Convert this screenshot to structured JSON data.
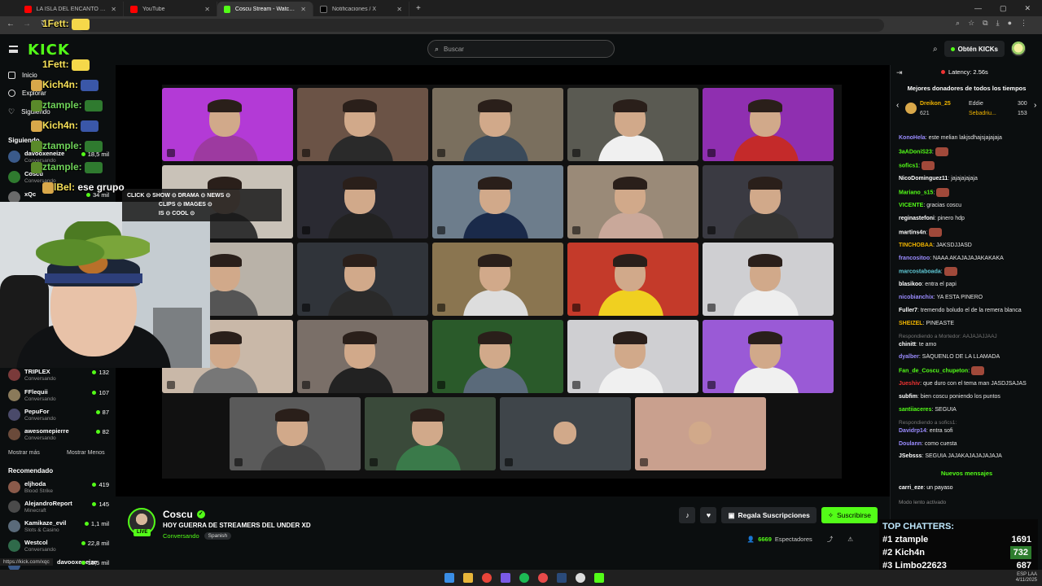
{
  "browser": {
    "tabs": [
      {
        "title": "LA ISLA DEL ENCANTO #81",
        "color": "#ff0000"
      },
      {
        "title": "YouTube",
        "color": "#ff0000"
      },
      {
        "title": "Coscu Stream - Watch Live",
        "color": "#53fc18"
      },
      {
        "title": "Notificaciones / X",
        "color": "#000000"
      }
    ],
    "new_tab": "+"
  },
  "header": {
    "logo": "KICK",
    "search_placeholder": "Buscar",
    "get_kicks": "Obtén KICKs"
  },
  "sidebar": {
    "nav": [
      {
        "label": "Inicio",
        "icon": "home-icon"
      },
      {
        "label": "Explorar",
        "icon": "compass-icon"
      },
      {
        "label": "Siguiendo",
        "icon": "heart-icon"
      }
    ],
    "following_title": "Siguiendo",
    "following": [
      {
        "name": "davooxeneize",
        "category": "Conversando",
        "viewers": "18,5 mil"
      },
      {
        "name": "Coscu",
        "category": "Conversando",
        "viewers": ""
      },
      {
        "name": "xQc",
        "category": "",
        "viewers": "34 mil"
      },
      {
        "name": "TRIPLEX",
        "category": "Conversando",
        "viewers": "132"
      },
      {
        "name": "FFlequii",
        "category": "Conversando",
        "viewers": "107"
      },
      {
        "name": "PepuFor",
        "category": "Conversando",
        "viewers": "87"
      },
      {
        "name": "awesomepierre",
        "category": "Conversando",
        "viewers": "82"
      }
    ],
    "show_more": "Mostrar más",
    "show_less": "Mostrar Menos",
    "recommended_title": "Recomendado",
    "recommended": [
      {
        "name": "eljhoda",
        "category": "Blood Strike",
        "viewers": "419"
      },
      {
        "name": "AlejandroReport",
        "category": "Minecraft",
        "viewers": "145"
      },
      {
        "name": "Kamikaze_evil",
        "category": "Slots & Casino",
        "viewers": "1,1 mil"
      },
      {
        "name": "Westcol",
        "category": "Conversando",
        "viewers": "22,8 mil"
      },
      {
        "name": "davooxeneize",
        "category": "",
        "viewers": "18,5 mil"
      }
    ],
    "status_url": "https://kick.com/xqc"
  },
  "overlay": {
    "lines": [
      "1Fett:",
      "1Fett:",
      "Kich4n:",
      "ztample:",
      "Kich4n:",
      "ztample:",
      "ztample:",
      "lBel:",
      "ese grupo"
    ],
    "tags": [
      "CLICK",
      "SHOW",
      "DRAMA",
      "NEWS",
      "CLIPS",
      "IMAGES",
      "IS",
      "COOL"
    ]
  },
  "stream": {
    "streamer": "Coscu",
    "live": "LIVE",
    "title": "HOY GUERRA DE STREAMERS DEL UNDER XD",
    "category": "Conversando",
    "language": "Spanish",
    "gift_label": "Regala Suscripciones",
    "subscribe_label": "Suscribirse",
    "viewers": "6669",
    "viewers_label": "Espectadores"
  },
  "chat": {
    "latency": "Latency: 2.56s",
    "donors_title": "Mejores donadores de todos los tiempos",
    "donors": [
      {
        "name": "Dreikon_25",
        "amount": "621"
      },
      {
        "name": "Eddie",
        "amount": "300"
      },
      {
        "name": "Sebadriu...",
        "amount": "153"
      }
    ],
    "messages": [
      {
        "user": "KonoHela",
        "color": "#9b8cff",
        "text": "este melian lakjsdhajsjajajaja"
      },
      {
        "user": "3aADoniS23",
        "color": "#53fc18",
        "text": ""
      },
      {
        "user": "sofics1",
        "color": "#53fc18",
        "text": ""
      },
      {
        "user": "NicoDominguez11",
        "color": "#ffffff",
        "text": "jajajajajaja"
      },
      {
        "user": "Mariano_s15",
        "color": "#53fc18",
        "text": ""
      },
      {
        "user": "VICENTE",
        "color": "#53fc18",
        "text": "gracias coscu"
      },
      {
        "user": "reginastefoni",
        "color": "#ffffff",
        "text": "pinero hdp"
      },
      {
        "user": "martins4n",
        "color": "#ffffff",
        "text": ""
      },
      {
        "user": "TINCHOBAA",
        "color": "#f0b400",
        "text": "JAKSDJJASD"
      },
      {
        "user": "francositoo",
        "color": "#9b8cff",
        "text": "NAAA AKAJAJAJAKAKAKA"
      },
      {
        "user": "marcostaboada",
        "color": "#5fc9d6",
        "text": ""
      },
      {
        "user": "blasikoo",
        "color": "#ffffff",
        "text": "entra el papi"
      },
      {
        "user": "nicobianchix",
        "color": "#9b8cff",
        "text": "YA ESTA PINERO"
      },
      {
        "user": "Fuller7",
        "color": "#ffffff",
        "text": "tremendo boludo el de la remera blanca"
      },
      {
        "user": "SHEIZEL",
        "color": "#f0b400",
        "text": "PINEASTE"
      },
      {
        "reply": "Respondiendo a Mortedor: AAJAJAJJAAJ",
        "user": "chinitt",
        "color": "#ffffff",
        "text": "te amo"
      },
      {
        "user": "dyalber",
        "color": "#9b8cff",
        "text": "SÁQUENLO DE LA LLAMADA"
      },
      {
        "user": "Fan_de_Coscu_chupeton",
        "color": "#53fc18",
        "text": ""
      },
      {
        "user": "Jueshiv",
        "color": "#e33",
        "text": "que duro con el tema man JASDJSAJAS"
      },
      {
        "user": "subfim",
        "color": "#ffffff",
        "text": "bien coscu poniendo los puntos"
      },
      {
        "user": "santiiaceres",
        "color": "#53fc18",
        "text": "SEGUIA"
      },
      {
        "reply": "Respondiendo a sofics1:",
        "user": "Davidrp14",
        "color": "#9b8cff",
        "text": "entra sofi"
      },
      {
        "user": "Doulann",
        "color": "#9b8cff",
        "text": "como cuesta"
      },
      {
        "user": "JSebsss",
        "color": "#ffffff",
        "text": "SEGUIA JAJAKAJAJAJAJAJA"
      }
    ],
    "new_messages": "Nuevos mensajes",
    "after": {
      "user": "carri_eze",
      "color": "#ffffff",
      "text": "un payaso"
    },
    "slow_mode": "Modo lento activado"
  },
  "top_chatters": {
    "title": "TOP CHATTERS:",
    "rows": [
      {
        "rank": "#1",
        "name": "ztample",
        "value": "1691"
      },
      {
        "rank": "#2",
        "name": "Kich4n",
        "value": "732"
      },
      {
        "rank": "#3",
        "name": "Limbo22623",
        "value": "687"
      }
    ]
  },
  "taskbar": {
    "lang": "ESP LAA",
    "date": "4/11/2025"
  }
}
